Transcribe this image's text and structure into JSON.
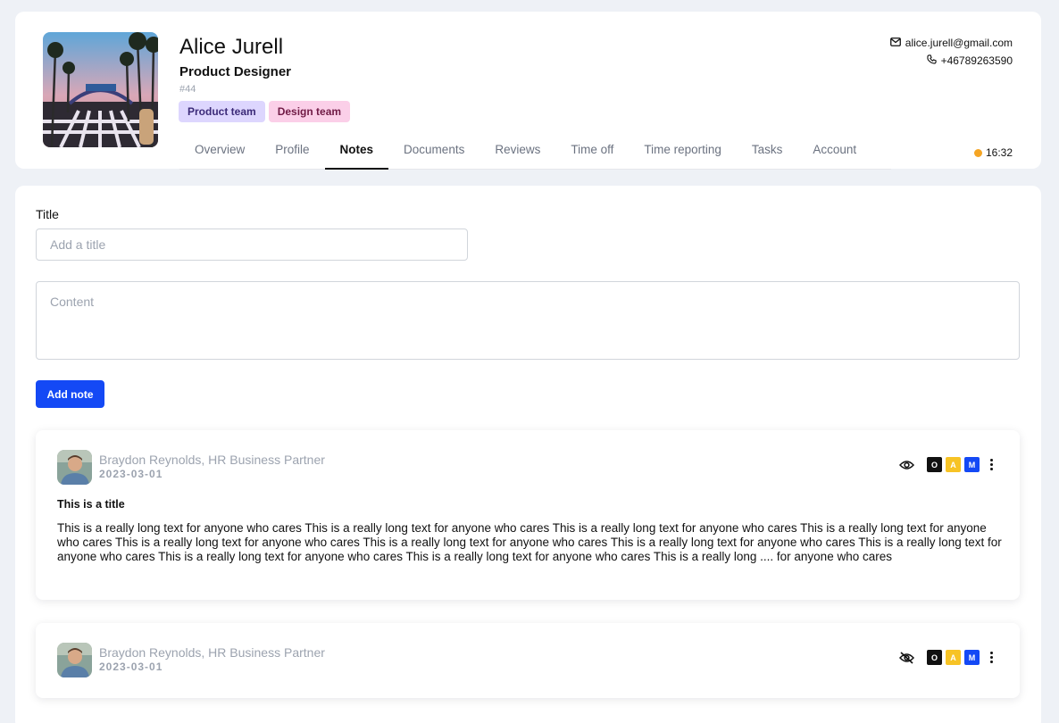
{
  "profile": {
    "name": "Alice Jurell",
    "job_title": "Product Designer",
    "employee_id": "#44",
    "tags": [
      "Product team",
      "Design team"
    ],
    "email": "alice.jurell@gmail.com",
    "phone": "+46789263590",
    "local_time": "16:32"
  },
  "tabs": [
    "Overview",
    "Profile",
    "Notes",
    "Documents",
    "Reviews",
    "Time off",
    "Time reporting",
    "Tasks",
    "Account"
  ],
  "active_tab": "Notes",
  "form": {
    "title_label": "Title",
    "title_placeholder": "Add a title",
    "content_placeholder": "Content",
    "add_button": "Add note"
  },
  "notes": [
    {
      "author": "Braydon Reynolds, HR Business Partner",
      "date": "2023-03-01",
      "visible": true,
      "badges": [
        "O",
        "A",
        "M"
      ],
      "title": "This is a title",
      "body": "This is a really long text for anyone who cares This is a really long text for anyone who cares This is a really long text for anyone who cares This is a really long text for anyone who cares This is a really long text for anyone who cares This is a really long text for anyone who cares This is a really long text for anyone who cares This is a really long text for anyone who cares This is a really long text for anyone who cares This is a really long text for anyone who cares This is a really long .... for anyone who cares"
    },
    {
      "author": "Braydon Reynolds, HR Business Partner",
      "date": "2023-03-01",
      "visible": false,
      "badges": [
        "O",
        "A",
        "M"
      ]
    }
  ],
  "icons": {
    "email": "mail-icon",
    "phone": "phone-icon",
    "time": "sun-icon",
    "visible": "eye-icon",
    "hidden": "eye-off-icon",
    "menu": "more-vertical-icon"
  },
  "colors": {
    "accent": "#1449f5",
    "badge_o": "#111111",
    "badge_a": "#f7c325",
    "badge_m": "#1449f5",
    "tag_purple": "#ddd6fe",
    "tag_pink": "#fbcfe8"
  }
}
